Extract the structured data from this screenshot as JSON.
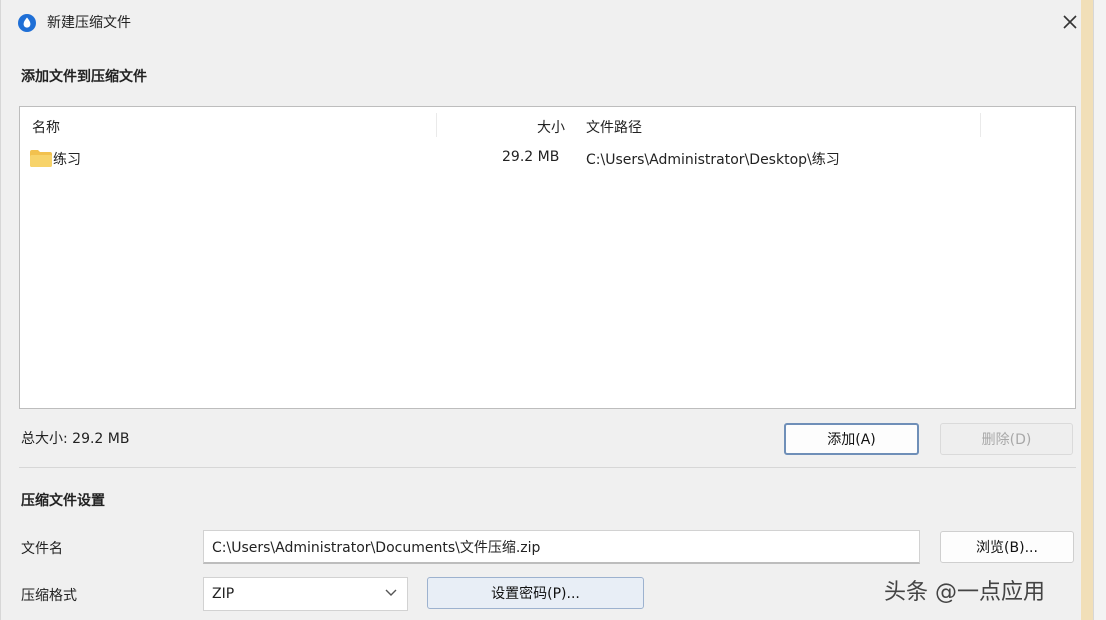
{
  "window": {
    "title": "新建压缩文件",
    "close_label": "✕"
  },
  "files_section": {
    "title": "添加文件到压缩文件",
    "columns": {
      "name": "名称",
      "size": "大小",
      "path": "文件路径"
    },
    "rows": [
      {
        "name": "练习",
        "size": "29.2 MB",
        "path": "C:\\Users\\Administrator\\Desktop\\练习"
      }
    ],
    "total_size": "总大小: 29.2 MB",
    "add_button": "添加(A)",
    "delete_button": "删除(D)"
  },
  "settings_section": {
    "title": "压缩文件设置",
    "filename_label": "文件名",
    "filename_value": "C:\\Users\\Administrator\\Documents\\文件压缩.zip",
    "browse_button": "浏览(B)...",
    "format_label": "压缩格式",
    "format_value": "ZIP",
    "password_button": "设置密码(P)..."
  },
  "watermark": "头条 @一点应用",
  "colors": {
    "accent_border": "#6f8fb8",
    "password_button_bg": "#e8eef6",
    "disabled_text": "#a8a8a8",
    "app_icon": "#1f6fd6"
  },
  "icons": {
    "app": "app-logo-icon",
    "close": "close-icon",
    "folder": "folder-icon",
    "dropdown": "chevron-down-icon"
  }
}
